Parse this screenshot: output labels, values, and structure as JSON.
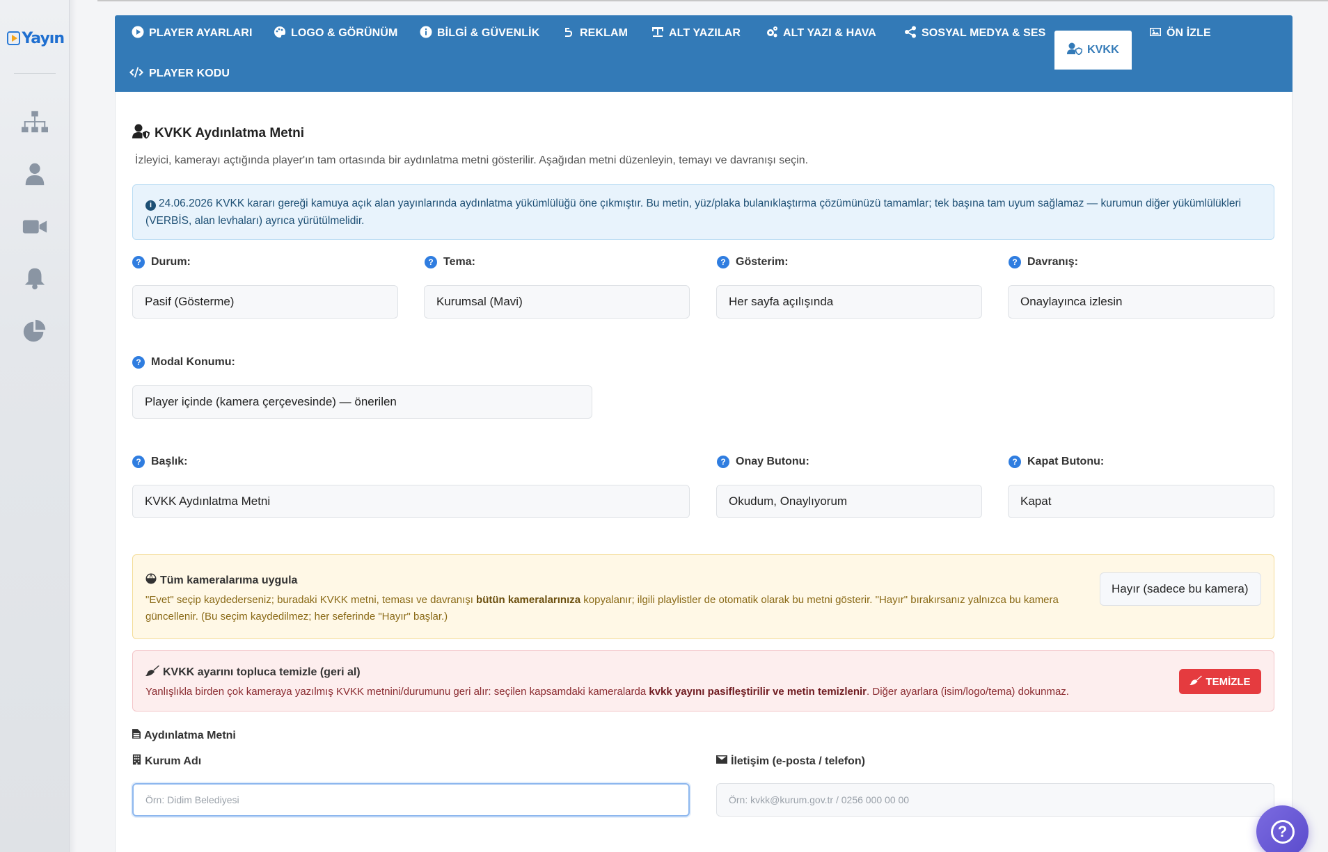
{
  "sidebar": {
    "logo_text": "Yayın",
    "icons": [
      "sitemap-icon",
      "user-icon",
      "video-camera-icon",
      "bell-icon",
      "pie-chart-icon"
    ]
  },
  "tabs": [
    {
      "label": "PLAYER AYARLARI",
      "icon": "play-circle-icon"
    },
    {
      "label": "LOGO & GÖRÜNÜM",
      "icon": "palette-icon"
    },
    {
      "label": "BİLGİ & GÜVENLİK",
      "icon": "info-circle-icon"
    },
    {
      "label": "REKLAM",
      "icon": "ad-icon"
    },
    {
      "label": "ALT YAZILAR",
      "icon": "subtitle-icon"
    },
    {
      "label": "ALT YAZI & HAVA",
      "icon": "cogs-icon"
    },
    {
      "label": "SOSYAL MEDYA & SES",
      "icon": "share-icon"
    },
    {
      "label": "KVKK",
      "icon": "user-shield-icon",
      "active": true
    },
    {
      "label": "ÖN İZLE",
      "icon": "image-icon"
    },
    {
      "label": "PLAYER KODU",
      "icon": "code-icon"
    }
  ],
  "section": {
    "title": "KVKK Aydınlatma Metni",
    "description": "İzleyici, kamerayı açtığında player'ın tam ortasında bir aydınlatma metni gösterilir. Aşağıdan metni düzenleyin, temayı ve davranışı seçin."
  },
  "info": {
    "text": "24.06.2026 KVKK kararı gereği kamuya açık alan yayınlarında aydınlatma yükümlülüğü öne çıkmıştır. Bu metin, yüz/plaka bulanıklaştırma çözümünüzü tamamlar; tek başına tam uyum sağlamaz — kurumun diğer yükümlülükleri (VERBİS, alan levhaları) ayrıca yürütülmelidir."
  },
  "fields": {
    "durum": {
      "label": "Durum:",
      "value": "Pasif (Gösterme)"
    },
    "tema": {
      "label": "Tema:",
      "value": "Kurumsal (Mavi)"
    },
    "gosterim": {
      "label": "Gösterim:",
      "value": "Her sayfa açılışında"
    },
    "davranis": {
      "label": "Davranış:",
      "value": "Onaylayınca izlesin"
    },
    "modal": {
      "label": "Modal Konumu:",
      "value": "Player içinde (kamera çerçevesinde) — önerilen"
    },
    "baslik": {
      "label": "Başlık:",
      "value": "KVKK Aydınlatma Metni"
    },
    "onay": {
      "label": "Onay Butonu:",
      "value": "Okudum, Onaylıyorum"
    },
    "kapat": {
      "label": "Kapat Butonu:",
      "value": "Kapat"
    }
  },
  "apply_all": {
    "title": "Tüm kameralarıma uygula",
    "text_1": "\"Evet\" seçip kaydederseniz; buradaki KVKK metni, teması ve davranışı ",
    "text_bold": "bütün kameralarınıza",
    "text_2": " kopyalanır; ilgili playlistler de otomatik olarak bu metni gösterir. \"Hayır\" bırakırsanız yalnızca bu kamera güncellenir. (Bu seçim kaydedilmez; her seferinde \"Hayır\" başlar.)",
    "select_value": "Hayır (sadece bu kamera)"
  },
  "bulk_clear": {
    "title": "KVKK ayarını topluca temizle (geri al)",
    "text_1": "Yanlışlıkla birden çok kameraya yazılmış KVKK metnini/durumunu geri alır: seçilen kapsamdaki kameralarda ",
    "text_bold": "kvkk yayını pasifleştirilir ve metin temizlenir",
    "text_2": ". Diğer ayarlara (isim/logo/tema) dokunmaz.",
    "button": "TEMİZLE"
  },
  "text_section": {
    "title": "Aydınlatma Metni",
    "kurum_label": "Kurum Adı",
    "kurum_placeholder": "Örn: Didim Belediyesi",
    "iletisim_label": "İletişim (e-posta / telefon)",
    "iletisim_placeholder": "Örn: kvkk@kurum.gov.tr / 0256 000 00 00"
  },
  "colors": {
    "primary": "#337ab7",
    "danger": "#e53b3f",
    "warning_bg": "#fff8e6",
    "info_bg": "#e8f3fc"
  }
}
